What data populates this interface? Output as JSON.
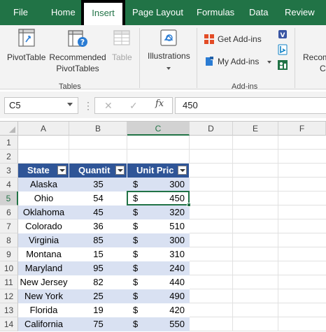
{
  "tabs": [
    {
      "label": "File"
    },
    {
      "label": "Home"
    },
    {
      "label": "Insert"
    },
    {
      "label": "Page Layout"
    },
    {
      "label": "Formulas"
    },
    {
      "label": "Data"
    },
    {
      "label": "Review"
    }
  ],
  "active_tab": "Insert",
  "ribbon": {
    "pivottable": "PivotTable",
    "recommended_line1": "Recommended",
    "recommended_line2": "PivotTables",
    "table": "Table",
    "tables_group": "Tables",
    "illustrations": "Illustrations",
    "get_addins": "Get Add-ins",
    "my_addins": "My Add-ins",
    "addins_group": "Add-ins",
    "reco_line1": "Recom",
    "reco_line2": "C"
  },
  "formula_bar": {
    "name_box": "C5",
    "fx": "fx",
    "cancel_glyph": "✕",
    "enter_glyph": "✓",
    "formula": "450"
  },
  "columns": [
    "A",
    "B",
    "C",
    "D",
    "E",
    "F"
  ],
  "selected_column": "C",
  "rows": [
    "1",
    "2",
    "3",
    "4",
    "5",
    "6",
    "7",
    "8",
    "9",
    "10",
    "11",
    "12",
    "13",
    "14"
  ],
  "selected_row": "5",
  "table": {
    "headers": [
      "State",
      "Quantit",
      "Unit Pric"
    ],
    "currency_symbol": "$",
    "rows": [
      {
        "state": "Alaska",
        "quantity": "35",
        "price": "300"
      },
      {
        "state": "Ohio",
        "quantity": "54",
        "price": "450"
      },
      {
        "state": "Oklahoma",
        "quantity": "45",
        "price": "320"
      },
      {
        "state": "Colorado",
        "quantity": "36",
        "price": "510"
      },
      {
        "state": "Virginia",
        "quantity": "85",
        "price": "300"
      },
      {
        "state": "Montana",
        "quantity": "15",
        "price": "310"
      },
      {
        "state": "Maryland",
        "quantity": "95",
        "price": "240"
      },
      {
        "state": "New Jersey",
        "quantity": "82",
        "price": "440"
      },
      {
        "state": "New York",
        "quantity": "25",
        "price": "490"
      },
      {
        "state": "Florida",
        "quantity": "19",
        "price": "420"
      },
      {
        "state": "California",
        "quantity": "75",
        "price": "550"
      }
    ]
  },
  "colors": {
    "ribbon_tab_bar": "#217346",
    "table_header": "#2f5597",
    "band_light": "#d9e1f2",
    "selection": "#217346"
  }
}
